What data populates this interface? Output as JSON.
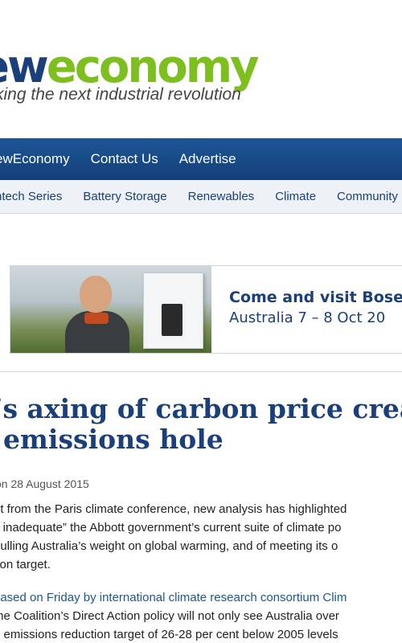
{
  "logo": {
    "part1": "ew",
    "part2": "economy",
    "tagline": "king the next industrial revolution"
  },
  "nav_primary": [
    "ewEconomy",
    "Contact Us",
    "Advertise"
  ],
  "nav_secondary": [
    "ntech Series",
    "Battery Storage",
    "Renewables",
    "Climate",
    "Community Po"
  ],
  "ad": {
    "line1": "Come and visit Bose",
    "line2": "Australia 7 – 8 Oct 20"
  },
  "article": {
    "headline_line1": "’s axing of carbon price crea",
    "headline_line2": "emissions hole",
    "dateline": "on 28 August 2015",
    "p1": [
      "ut from the Paris climate conference, new analysis has highlighted",
      "y inadequate” the Abbott government’s current suite of climate po",
      "pulling Australia’s weight on global warming, and of meeting its o",
      "tion target."
    ],
    "p2_link": "eased on Friday by international climate research consortium Clim",
    "p2": [
      "the Coalition’s Direct Action policy will not only see Australia over",
      "0 emissions reduction target of 26-28 per cent below 2005 levels"
    ]
  }
}
